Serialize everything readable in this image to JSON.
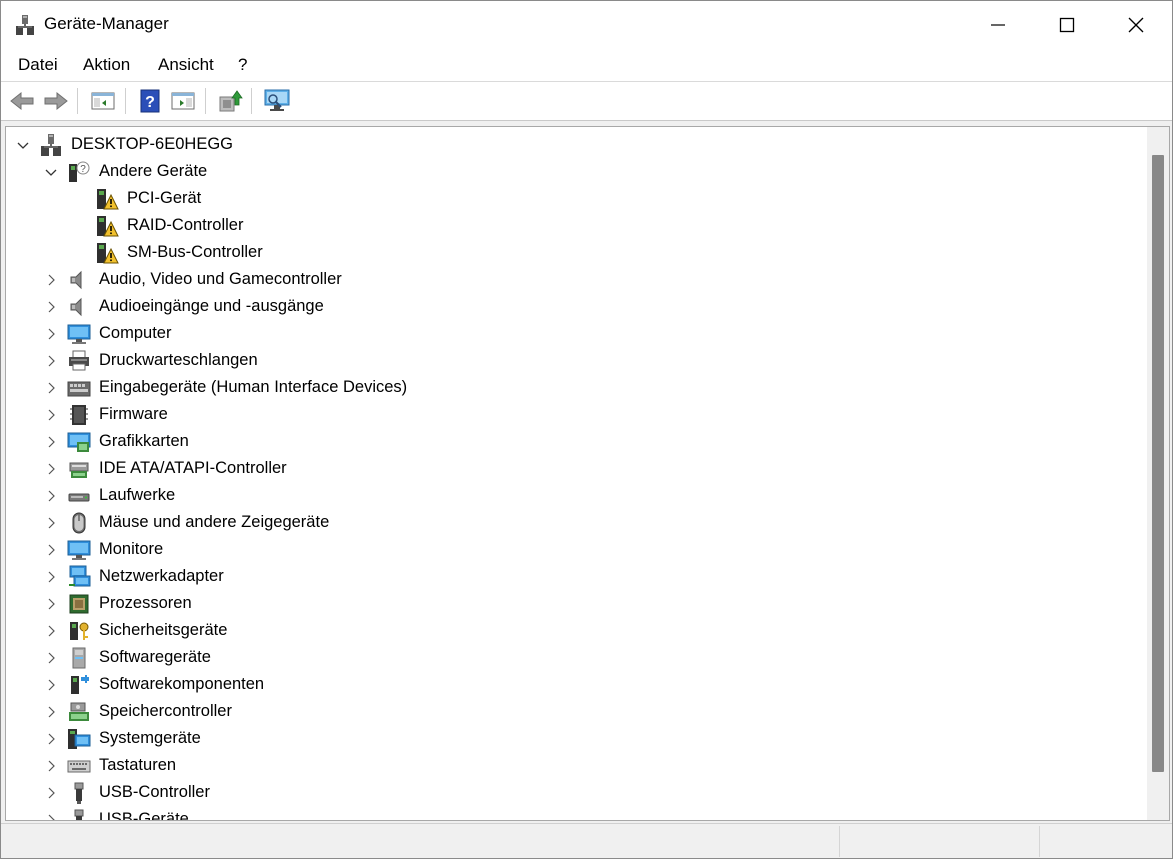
{
  "window": {
    "title": "Geräte-Manager"
  },
  "menu": [
    {
      "name": "menu-datei",
      "label": "Datei"
    },
    {
      "name": "menu-aktion",
      "label": "Aktion"
    },
    {
      "name": "menu-ansicht",
      "label": "Ansicht"
    },
    {
      "name": "menu-help",
      "label": "?"
    }
  ],
  "toolbar": {
    "buttons": [
      "back-icon",
      "forward-icon",
      "show-hide-console-tree-icon",
      "help-icon",
      "action-pane-icon",
      "update-driver-icon",
      "scan-hardware-changes-icon"
    ]
  },
  "tree": {
    "root": "DESKTOP-6E0HEGG",
    "andere": {
      "label": "Andere Geräte",
      "children": [
        "PCI-Gerät",
        "RAID-Controller",
        "SM-Bus-Controller"
      ]
    },
    "categories": [
      {
        "label": "Audio, Video und Gamecontroller",
        "icon": "speaker-icon"
      },
      {
        "label": "Audioeingänge und -ausgänge",
        "icon": "speaker-icon"
      },
      {
        "label": "Computer",
        "icon": "computer-icon"
      },
      {
        "label": "Druckwarteschlangen",
        "icon": "printer-icon"
      },
      {
        "label": "Eingabegeräte (Human Interface Devices)",
        "icon": "hid-icon"
      },
      {
        "label": "Firmware",
        "icon": "firmware-chip-icon"
      },
      {
        "label": "Grafikkarten",
        "icon": "display-adapter-icon"
      },
      {
        "label": "IDE ATA/ATAPI-Controller",
        "icon": "ide-controller-icon"
      },
      {
        "label": "Laufwerke",
        "icon": "disk-drive-icon"
      },
      {
        "label": "Mäuse und andere Zeigegeräte",
        "icon": "mouse-icon"
      },
      {
        "label": "Monitore",
        "icon": "monitor-icon"
      },
      {
        "label": "Netzwerkadapter",
        "icon": "network-adapter-icon"
      },
      {
        "label": "Prozessoren",
        "icon": "processor-icon"
      },
      {
        "label": "Sicherheitsgeräte",
        "icon": "security-key-icon"
      },
      {
        "label": "Softwaregeräte",
        "icon": "software-device-icon"
      },
      {
        "label": "Softwarekomponenten",
        "icon": "software-component-icon"
      },
      {
        "label": "Speichercontroller",
        "icon": "storage-controller-icon"
      },
      {
        "label": "Systemgeräte",
        "icon": "system-devices-icon"
      },
      {
        "label": "Tastaturen",
        "icon": "keyboard-icon"
      },
      {
        "label": "USB-Controller",
        "icon": "usb-icon"
      },
      {
        "label": "USB-Geräte",
        "icon": "usb-icon"
      }
    ]
  }
}
